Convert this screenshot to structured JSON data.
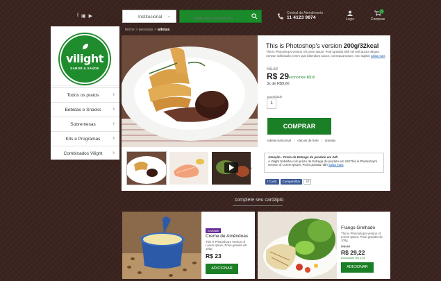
{
  "header": {
    "social_icons": [
      "facebook-icon",
      "instagram-icon",
      "youtube-icon"
    ],
    "category_select": "Institucional",
    "search_placeholder": "Digite aqui o que procura",
    "phone_label": "Central de Atendimento",
    "phone_number": "11 4123 9874",
    "login_label": "Login",
    "cart_label": "Compras",
    "cart_count": "0"
  },
  "logo": {
    "name": "vilight",
    "tagline": "SABOR & SAÚDE"
  },
  "sidebar": {
    "items": [
      {
        "label": "Todos os pratos"
      },
      {
        "label": "Bebidas e Snacks"
      },
      {
        "label": "Sobremesas"
      },
      {
        "label": "Kits e Programas"
      },
      {
        "label": "Combinados Vilight"
      }
    ]
  },
  "breadcrumb": {
    "home": "home",
    "sep": ">",
    "section": "pessoas",
    "current": "atletas"
  },
  "product": {
    "title_prefix": "This is Photoshop's version ",
    "title_bold": "200g/32kcal",
    "description": "This is Photoshop's version of Lorem Ipsum. Proin gravida nibh vel velit auctor aliquet. Aenean sollicitudin, lorem quis bibendum auctor, consequat ipsum, nec sagittis",
    "more_link": "saiba mais",
    "old_price": "R$ 39",
    "price": "R$ 29",
    "economy": "economize R$10",
    "installments": "3x de R$9,66",
    "quantity_label": "quantidade",
    "quantity": "1",
    "buy_label": "COMPRAR",
    "tabs": [
      "tabela nutricional",
      "cálculo de frete",
      "dúvidas"
    ],
    "notice_title": "Atenção - Prazo de Entrega do produto em 24h",
    "notice_text": "A Vilight trabalha com prazo de Entrega do produto em 24hThis is Photoshop's version of Lorem Ipsum, Proin gravida nibh",
    "notice_link": "saiba mais",
    "fb_like": "Curtir",
    "fb_share": "Compartilhar",
    "fb_count": "20"
  },
  "complete": {
    "title": "complete seu cardápio"
  },
  "recommendations": [
    {
      "badge": "novidade",
      "name": "Creme de Amêndoas",
      "desc": "This is Photoshop's version of Lorem Ipsum, Proin gravida nib 100g",
      "price": "R$ 23",
      "button": "ADICIONAR"
    },
    {
      "name": "Frango Grelhado",
      "desc": "This is Photoshop's version of Lorem Ipsum, Proin gravida nib 100g",
      "old_price": "R$ 32",
      "price": "R$ 29,22",
      "economy": "economize R$ 3,15",
      "button": "ADICIONAR"
    }
  ],
  "colors": {
    "accent": "#1a7f25",
    "background": "#3b2420",
    "badge": "#6b2e99"
  }
}
